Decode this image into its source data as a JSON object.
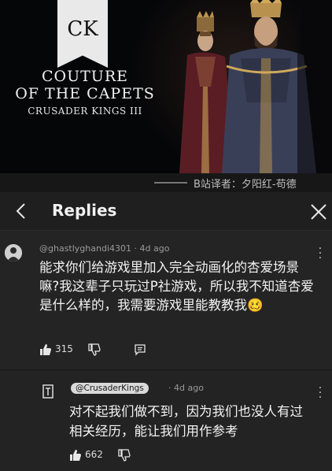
{
  "banner": {
    "logo_text": "CK",
    "title_line1": "COUTURE",
    "title_line2": "OF THE CAPETS",
    "game_name": "CRUSADER KINGS III"
  },
  "translator_credit": "B站译者：夕阳红-苟德",
  "header": {
    "title": "Replies",
    "back_icon": "chevron-left-icon",
    "close_icon": "close-icon"
  },
  "comments": [
    {
      "author": "@ghastlyghandi4301",
      "age": "· 4d ago",
      "text": "能求你们给游戏里加入完全动画化的杏爱场景嘛?我这辈子只玩过P社游戏，所以我不知道杏爱是什么样的，我需要游戏里能教教我🥴",
      "likes": "315"
    },
    {
      "author": "@CrusaderKings",
      "age": "· 4d ago",
      "text": "对不起我们做不到，因为我们也没人有过相关经历，能让我们用作参考",
      "likes": "662"
    }
  ],
  "colors": {
    "background": "#181818",
    "comment_bg": "#242424",
    "muted_text": "#9b9b9b",
    "badge_bg": "#d9d9d9"
  }
}
